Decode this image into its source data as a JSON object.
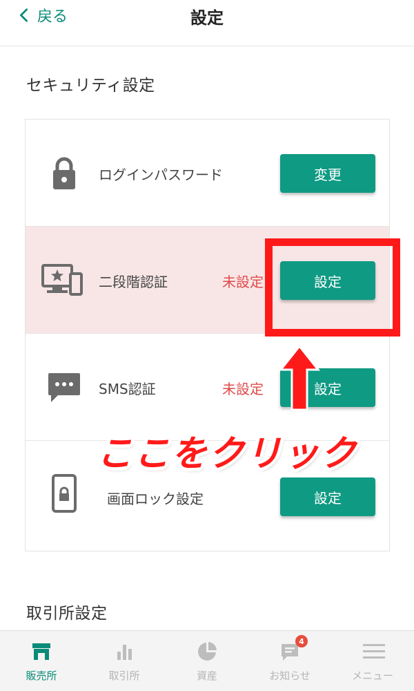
{
  "header": {
    "back_label": "戻る",
    "title": "設定"
  },
  "sections": {
    "security_title": "セキュリティ設定",
    "exchange_title": "取引所設定"
  },
  "security_rows": [
    {
      "label": "ログインパスワード",
      "status": "",
      "button": "変更",
      "icon": "lock-icon"
    },
    {
      "label": "二段階認証",
      "status": "未設定",
      "button": "設定",
      "icon": "devices-icon"
    },
    {
      "label": "SMS認証",
      "status": "未設定",
      "button": "設定",
      "icon": "message-icon"
    },
    {
      "label": "画面ロック設定",
      "status": "",
      "button": "設定",
      "icon": "phone-lock-icon"
    }
  ],
  "annotation": {
    "text": "ここをクリック"
  },
  "bottom_nav": [
    {
      "label": "販売所",
      "icon": "shop-icon",
      "active": true
    },
    {
      "label": "取引所",
      "icon": "bar-chart-icon",
      "active": false
    },
    {
      "label": "資産",
      "icon": "pie-chart-icon",
      "active": false
    },
    {
      "label": "お知らせ",
      "icon": "notification-icon",
      "active": false,
      "badge": "4"
    },
    {
      "label": "メニュー",
      "icon": "menu-icon",
      "active": false
    }
  ],
  "colors": {
    "accent": "#0f9a83",
    "warning": "#e04a4a",
    "highlight_row": "#f8e6e6",
    "annotation_red": "#ff1a1a"
  }
}
